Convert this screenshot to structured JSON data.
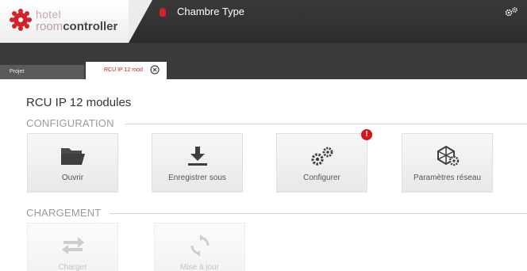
{
  "header": {
    "logo_line1": "hotel",
    "logo_line2_prefix": "room",
    "logo_line2_bold": "controller",
    "room_title": "Chambre Type"
  },
  "tabs": [
    {
      "label": "Projet",
      "active": false
    },
    {
      "label": "RCU IP 12 mod",
      "active": true
    }
  ],
  "page": {
    "title": "RCU IP 12 modules"
  },
  "configuration": {
    "title": "CONFIGURATION",
    "tiles": [
      {
        "label": "Ouvrir",
        "icon": "folder-icon",
        "enabled": true
      },
      {
        "label": "Enregistrer sous",
        "icon": "download-icon",
        "enabled": true
      },
      {
        "label": "Configurer",
        "icon": "gears-icon",
        "enabled": true,
        "alert": "!"
      },
      {
        "label": "Paramètres réseau",
        "icon": "network-settings-icon",
        "enabled": true
      }
    ]
  },
  "chargement": {
    "title": "CHARGEMENT",
    "tiles": [
      {
        "label": "Charger",
        "icon": "transfer-arrows-icon",
        "enabled": false
      },
      {
        "label": "Mise à jour",
        "icon": "refresh-icon",
        "enabled": false
      }
    ]
  },
  "colors": {
    "header_bg": "#2c2c2c",
    "accent_red": "#d3232a",
    "tile_bg": "#efefef",
    "section_text": "#9a9a9a"
  }
}
